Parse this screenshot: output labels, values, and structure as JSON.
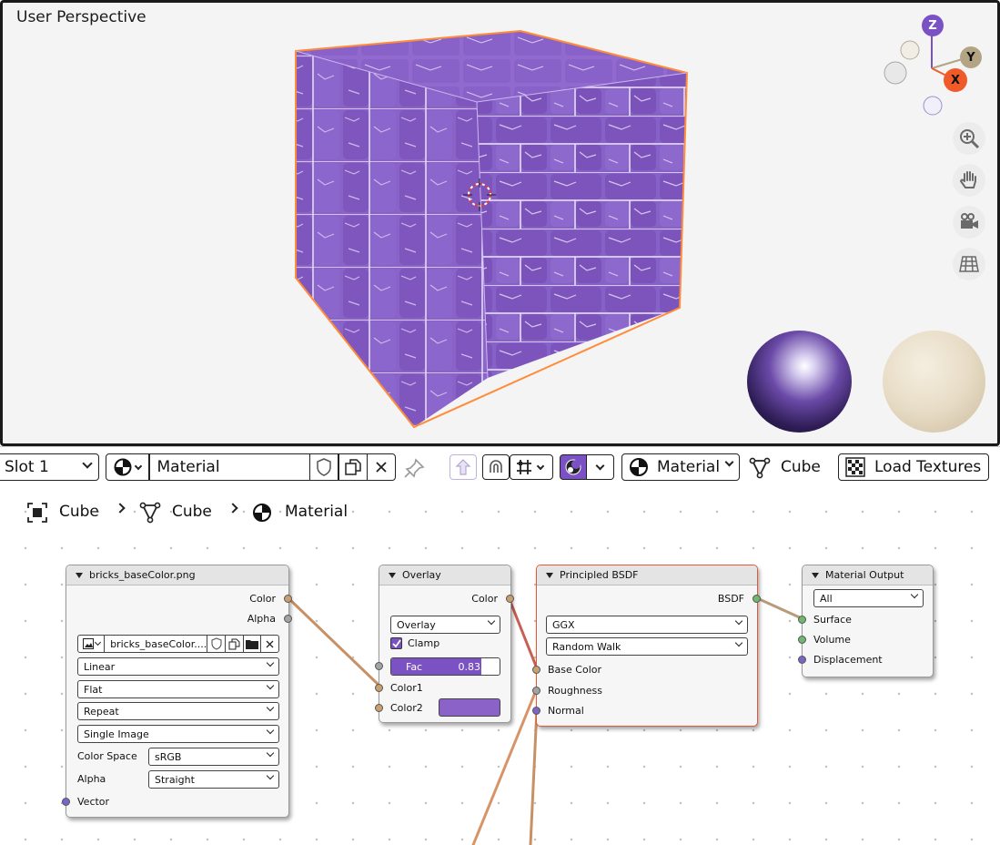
{
  "viewport": {
    "title": "User Perspective",
    "gizmo": {
      "z": "Z",
      "y": "Y",
      "x": "X"
    },
    "nav_icons": [
      "zoom-icon",
      "hand-pan-icon",
      "camera-icon",
      "grid-ortho-icon"
    ],
    "colors": {
      "cube": "#8a62c8",
      "outline": "#ff8c3a",
      "axis_z": "#7b52c3",
      "axis_y": "#b3a584",
      "axis_x": "#f05a28"
    }
  },
  "header": {
    "slot": "Slot 1",
    "material_name": "Material",
    "shading_mode": "Material",
    "object_label": "Cube",
    "load_textures": "Load Textures"
  },
  "breadcrumb": {
    "object": "Cube",
    "mesh": "Cube",
    "material": "Material"
  },
  "nodes": {
    "image": {
      "title": "bricks_baseColor.png",
      "outputs": [
        "Color",
        "Alpha"
      ],
      "image_field": "bricks_baseColor....",
      "interpolation": "Linear",
      "projection": "Flat",
      "extension": "Repeat",
      "source": "Single Image",
      "color_space_label": "Color Space",
      "color_space": "sRGB",
      "alpha_label": "Alpha",
      "alpha": "Straight",
      "input": "Vector"
    },
    "overlay": {
      "title": "Overlay",
      "output": "Color",
      "blend_mode": "Overlay",
      "clamp": "Clamp",
      "fac_label": "Fac",
      "fac_value": "0.833",
      "fac": 0.833,
      "color1": "Color1",
      "color2": "Color2",
      "color2_swatch": "#8a62c8"
    },
    "bsdf": {
      "title": "Principled BSDF",
      "output": "BSDF",
      "distribution": "GGX",
      "subsurface": "Random Walk",
      "inputs": [
        "Base Color",
        "Roughness",
        "Normal"
      ]
    },
    "output": {
      "title": "Material Output",
      "target": "All",
      "inputs": [
        "Surface",
        "Volume",
        "Displacement"
      ]
    }
  }
}
